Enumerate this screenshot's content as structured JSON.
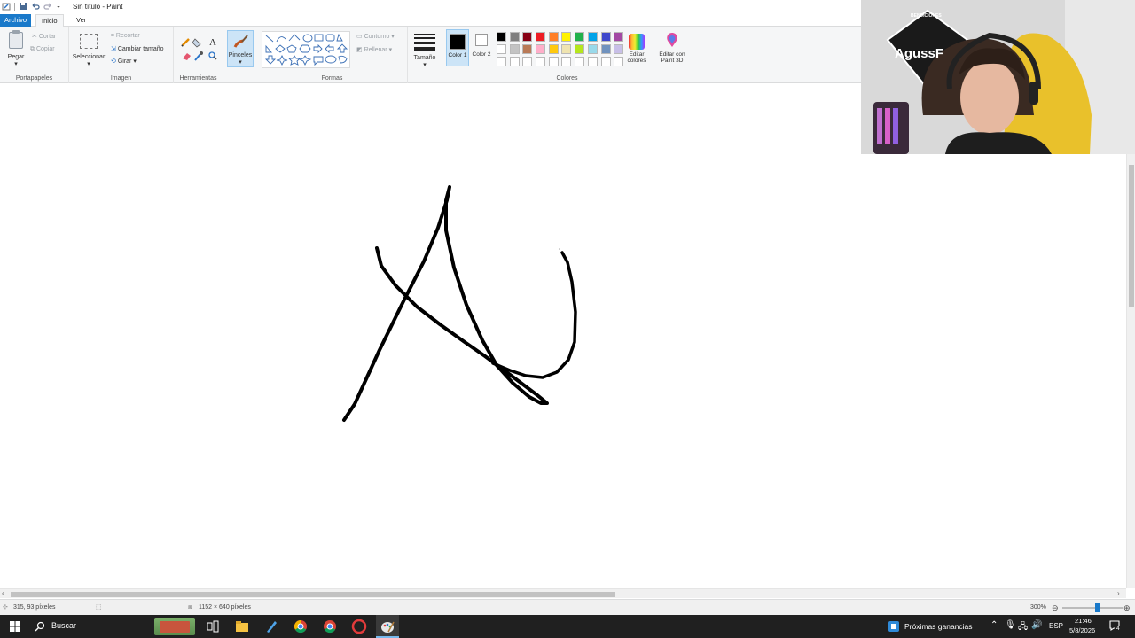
{
  "window": {
    "title": "Sin título - Paint"
  },
  "tabs": {
    "file": "Archivo",
    "home": "Inicio",
    "view": "Ver"
  },
  "clipboard": {
    "paste": "Pegar",
    "cut": "Cortar",
    "copy": "Copiar",
    "group": "Portapapeles"
  },
  "image": {
    "select": "Seleccionar",
    "crop": "Recortar",
    "resize": "Cambiar tamaño",
    "rotate": "Girar",
    "group": "Imagen"
  },
  "tools": {
    "group": "Herramientas",
    "brushes": "Pinceles"
  },
  "shapes": {
    "outline": "Contorno",
    "fill": "Rellenar",
    "group": "Formas"
  },
  "size": {
    "label": "Tamaño"
  },
  "colors": {
    "color1": "Color 1",
    "color2": "Color 2",
    "edit": "Editar colores",
    "paint3d": "Editar con Paint 3D",
    "group": "Colores",
    "palette": [
      "#000000",
      "#7f7f7f",
      "#880015",
      "#ed1c24",
      "#ff7f27",
      "#fff200",
      "#22b14c",
      "#00a2e8",
      "#3f48cc",
      "#a349a4",
      "#ffffff",
      "#c3c3c3",
      "#b97a57",
      "#ffaec9",
      "#ffc90e",
      "#efe4b0",
      "#b5e61d",
      "#99d9ea",
      "#7092be",
      "#c8bfe7",
      "#ffffff",
      "#ffffff",
      "#ffffff",
      "#ffffff",
      "#ffffff",
      "#ffffff",
      "#ffffff",
      "#ffffff",
      "#ffffff",
      "#ffffff"
    ]
  },
  "status": {
    "cursor_pos": "315, 93 píxeles",
    "canvas_size": "1152 × 640 píxeles",
    "zoom": "300%"
  },
  "taskbar": {
    "search_placeholder": "Buscar",
    "widget": "Próximas ganancias",
    "lang": "ESP",
    "time": "21:46",
    "date": "5/8/2026",
    "notifications": "4"
  },
  "webcam": {
    "badge_text": "AgussF",
    "badge_top": "BENDICIONES"
  }
}
